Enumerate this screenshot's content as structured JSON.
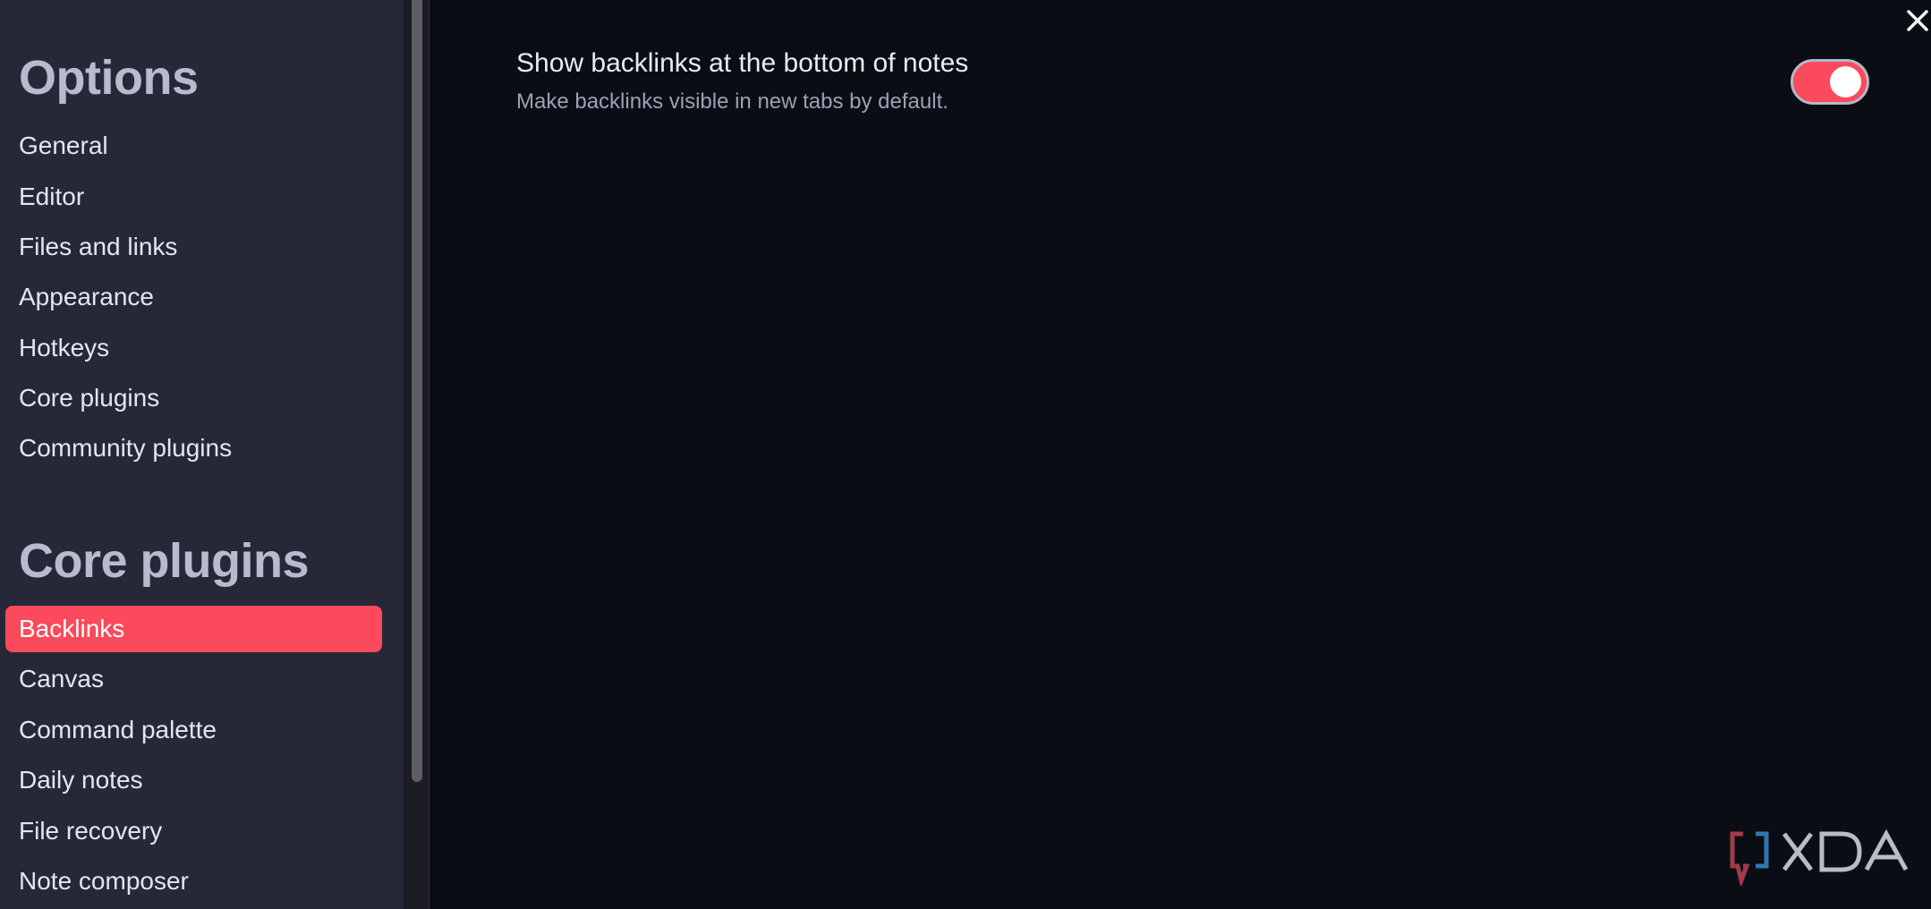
{
  "sidebar": {
    "options_heading": "Options",
    "options_items": [
      {
        "label": "General"
      },
      {
        "label": "Editor"
      },
      {
        "label": "Files and links"
      },
      {
        "label": "Appearance"
      },
      {
        "label": "Hotkeys"
      },
      {
        "label": "Core plugins"
      },
      {
        "label": "Community plugins"
      }
    ],
    "core_heading": "Core plugins",
    "core_items": [
      {
        "label": "Backlinks",
        "active": true
      },
      {
        "label": "Canvas"
      },
      {
        "label": "Command palette"
      },
      {
        "label": "Daily notes"
      },
      {
        "label": "File recovery"
      },
      {
        "label": "Note composer"
      }
    ]
  },
  "setting": {
    "name": "Show backlinks at the bottom of notes",
    "description": "Make backlinks visible in new tabs by default.",
    "toggle_on": true
  },
  "icons": {
    "close": "close-icon",
    "watermark": "xda-logo",
    "watermark_text": "XDA"
  },
  "colors": {
    "accent": "#fa4a5b",
    "sidebar_bg": "#262838",
    "content_bg": "#0b0d14"
  }
}
